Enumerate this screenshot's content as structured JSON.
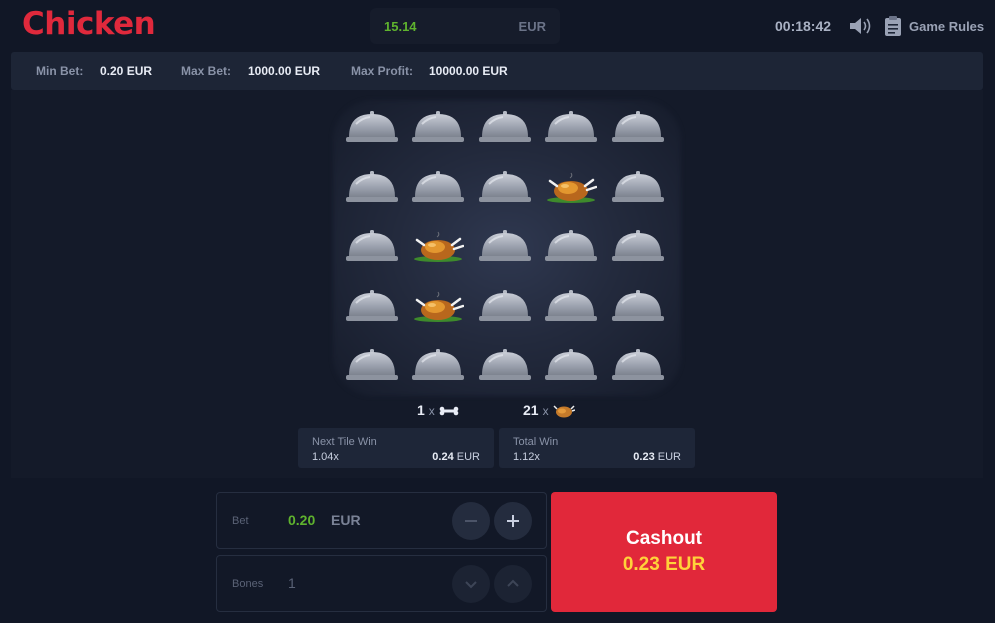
{
  "header": {
    "logo": "Chicken",
    "balance": {
      "amount": "15.14",
      "currency": "EUR"
    },
    "clock": "00:18:42",
    "rules_label": "Game Rules"
  },
  "limits": {
    "min_bet_label": "Min Bet:",
    "min_bet_value": "0.20 EUR",
    "max_bet_label": "Max Bet:",
    "max_bet_value": "1000.00 EUR",
    "max_profit_label": "Max Profit:",
    "max_profit_value": "10000.00 EUR"
  },
  "board": {
    "rows": [
      [
        "cloche",
        "cloche",
        "cloche",
        "cloche",
        "cloche"
      ],
      [
        "cloche",
        "cloche",
        "cloche",
        "chicken",
        "cloche"
      ],
      [
        "cloche",
        "chicken",
        "cloche",
        "cloche",
        "cloche"
      ],
      [
        "cloche",
        "chicken",
        "cloche",
        "cloche",
        "cloche"
      ],
      [
        "cloche",
        "cloche",
        "cloche",
        "cloche",
        "cloche"
      ]
    ],
    "bones_count": "1",
    "chickens_count": "21",
    "times": "x"
  },
  "next_tile_win": {
    "label": "Next Tile Win",
    "multiplier": "1.04x",
    "amount": "0.24",
    "currency": "EUR"
  },
  "total_win": {
    "label": "Total Win",
    "multiplier": "1.12x",
    "amount": "0.23",
    "currency": "EUR"
  },
  "bet_control": {
    "label": "Bet",
    "value": "0.20",
    "currency": "EUR"
  },
  "bones_control": {
    "label": "Bones",
    "value": "1"
  },
  "cashout": {
    "label": "Cashout",
    "amount": "0.23 EUR"
  },
  "colors": {
    "brand_red": "#e1283a",
    "balance_green": "#5fb32e",
    "cashout_amount": "#ffd23a"
  }
}
